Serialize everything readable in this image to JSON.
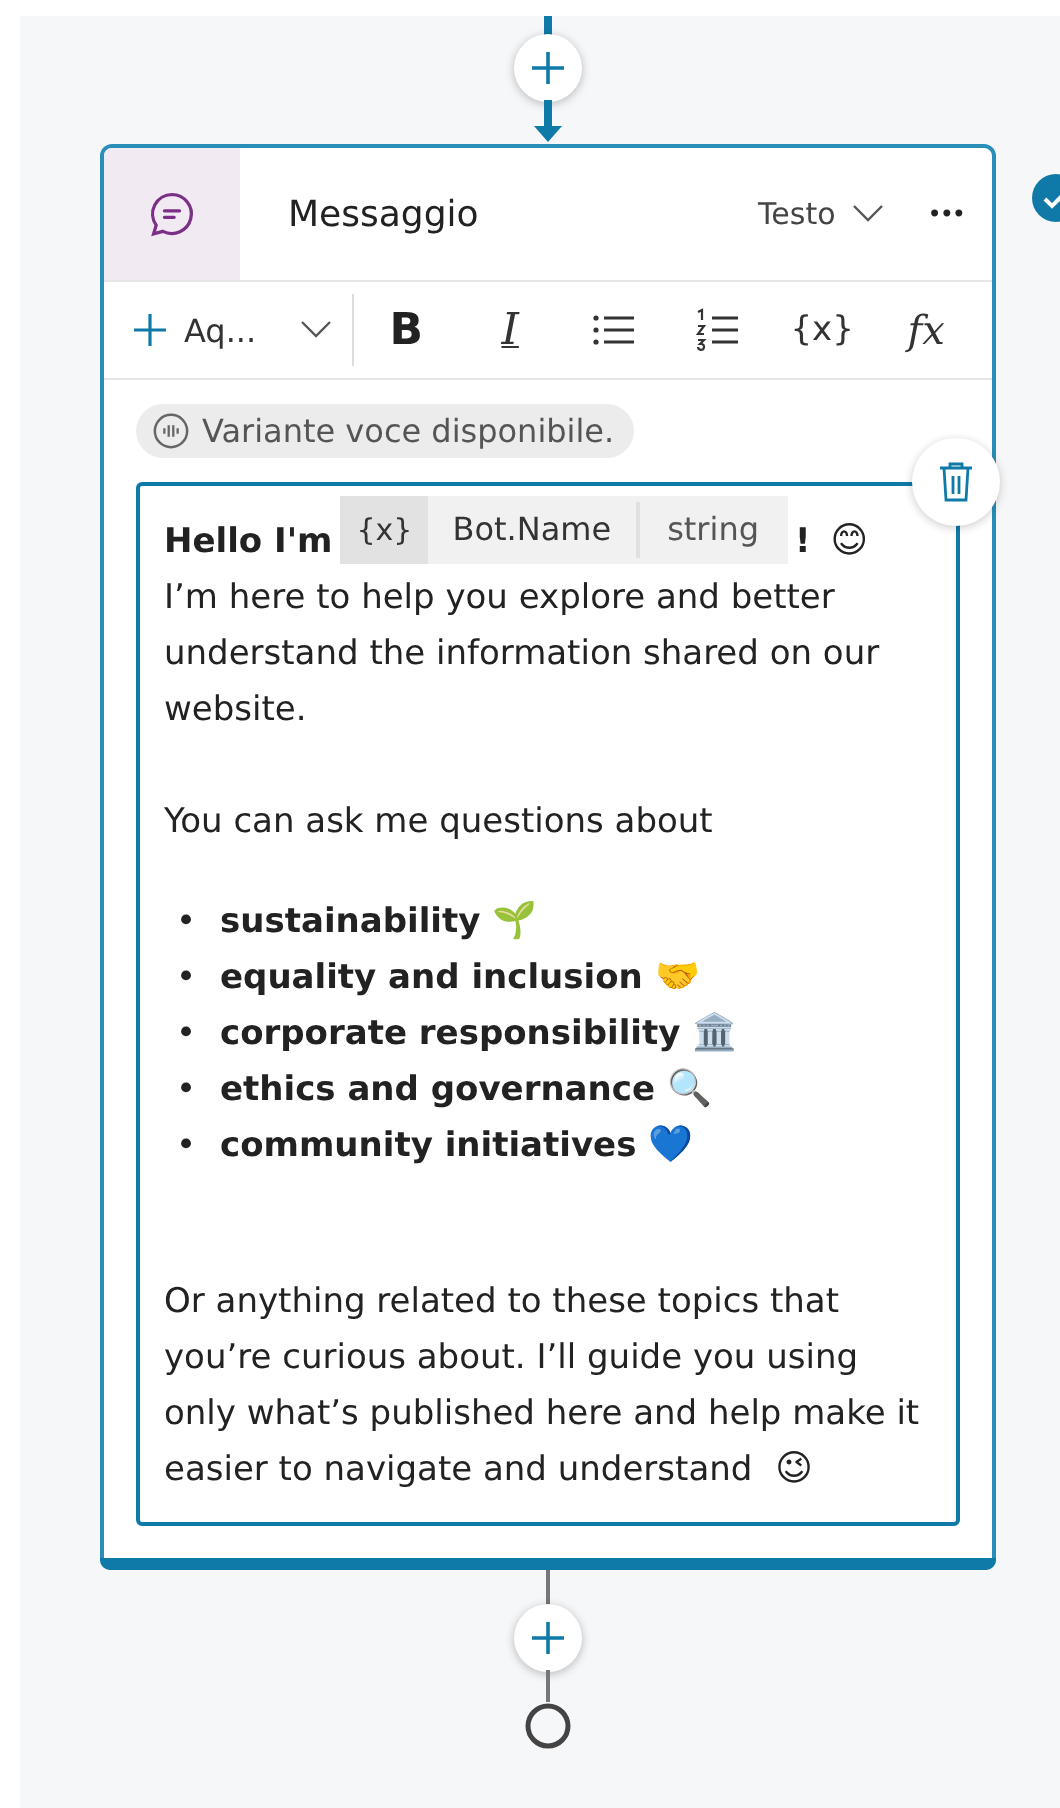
{
  "node": {
    "title": "Messaggio",
    "format": "Testo",
    "more": "•••",
    "toolbar": {
      "add_label": "Aq...",
      "items": [
        {
          "kind": "bold",
          "label": "B"
        },
        {
          "kind": "italic",
          "label": "I"
        },
        {
          "kind": "bullets"
        },
        {
          "kind": "numbered"
        },
        {
          "kind": "variable",
          "label": "{x}"
        },
        {
          "kind": "formula",
          "label": "fx"
        }
      ]
    },
    "variant_chip": "Variante voce disponibile.",
    "message": [
      {
        "kind": "greeting",
        "before": "Hello I'm",
        "variable": {
          "symbol": "{x}",
          "name": "Bot.Name",
          "type": "string"
        },
        "after": "!",
        "emoji": "😊"
      },
      {
        "kind": "paragraph",
        "text": "I’m here to help you explore and better understand the information shared on our website."
      },
      {
        "kind": "paragraph",
        "text": "You can ask me questions about"
      },
      {
        "kind": "bullets",
        "items": [
          {
            "marker": "•",
            "text": "sustainability",
            "emoji": "🌱"
          },
          {
            "marker": "•",
            "text": "equality and inclusion",
            "emoji": "🤝"
          },
          {
            "marker": "•",
            "text": "corporate responsibility",
            "emoji": "🏛️"
          },
          {
            "marker": "•",
            "text": "ethics and governance",
            "emoji": "🔍"
          },
          {
            "marker": "•",
            "text": "community initiatives",
            "emoji": "💙"
          }
        ]
      },
      {
        "kind": "paragraph",
        "text": "Or anything related to these topics that you’re curious about. I’ll guide you using only what’s published here and help make it easier to navigate and understand",
        "emoji": "😉"
      }
    ]
  }
}
